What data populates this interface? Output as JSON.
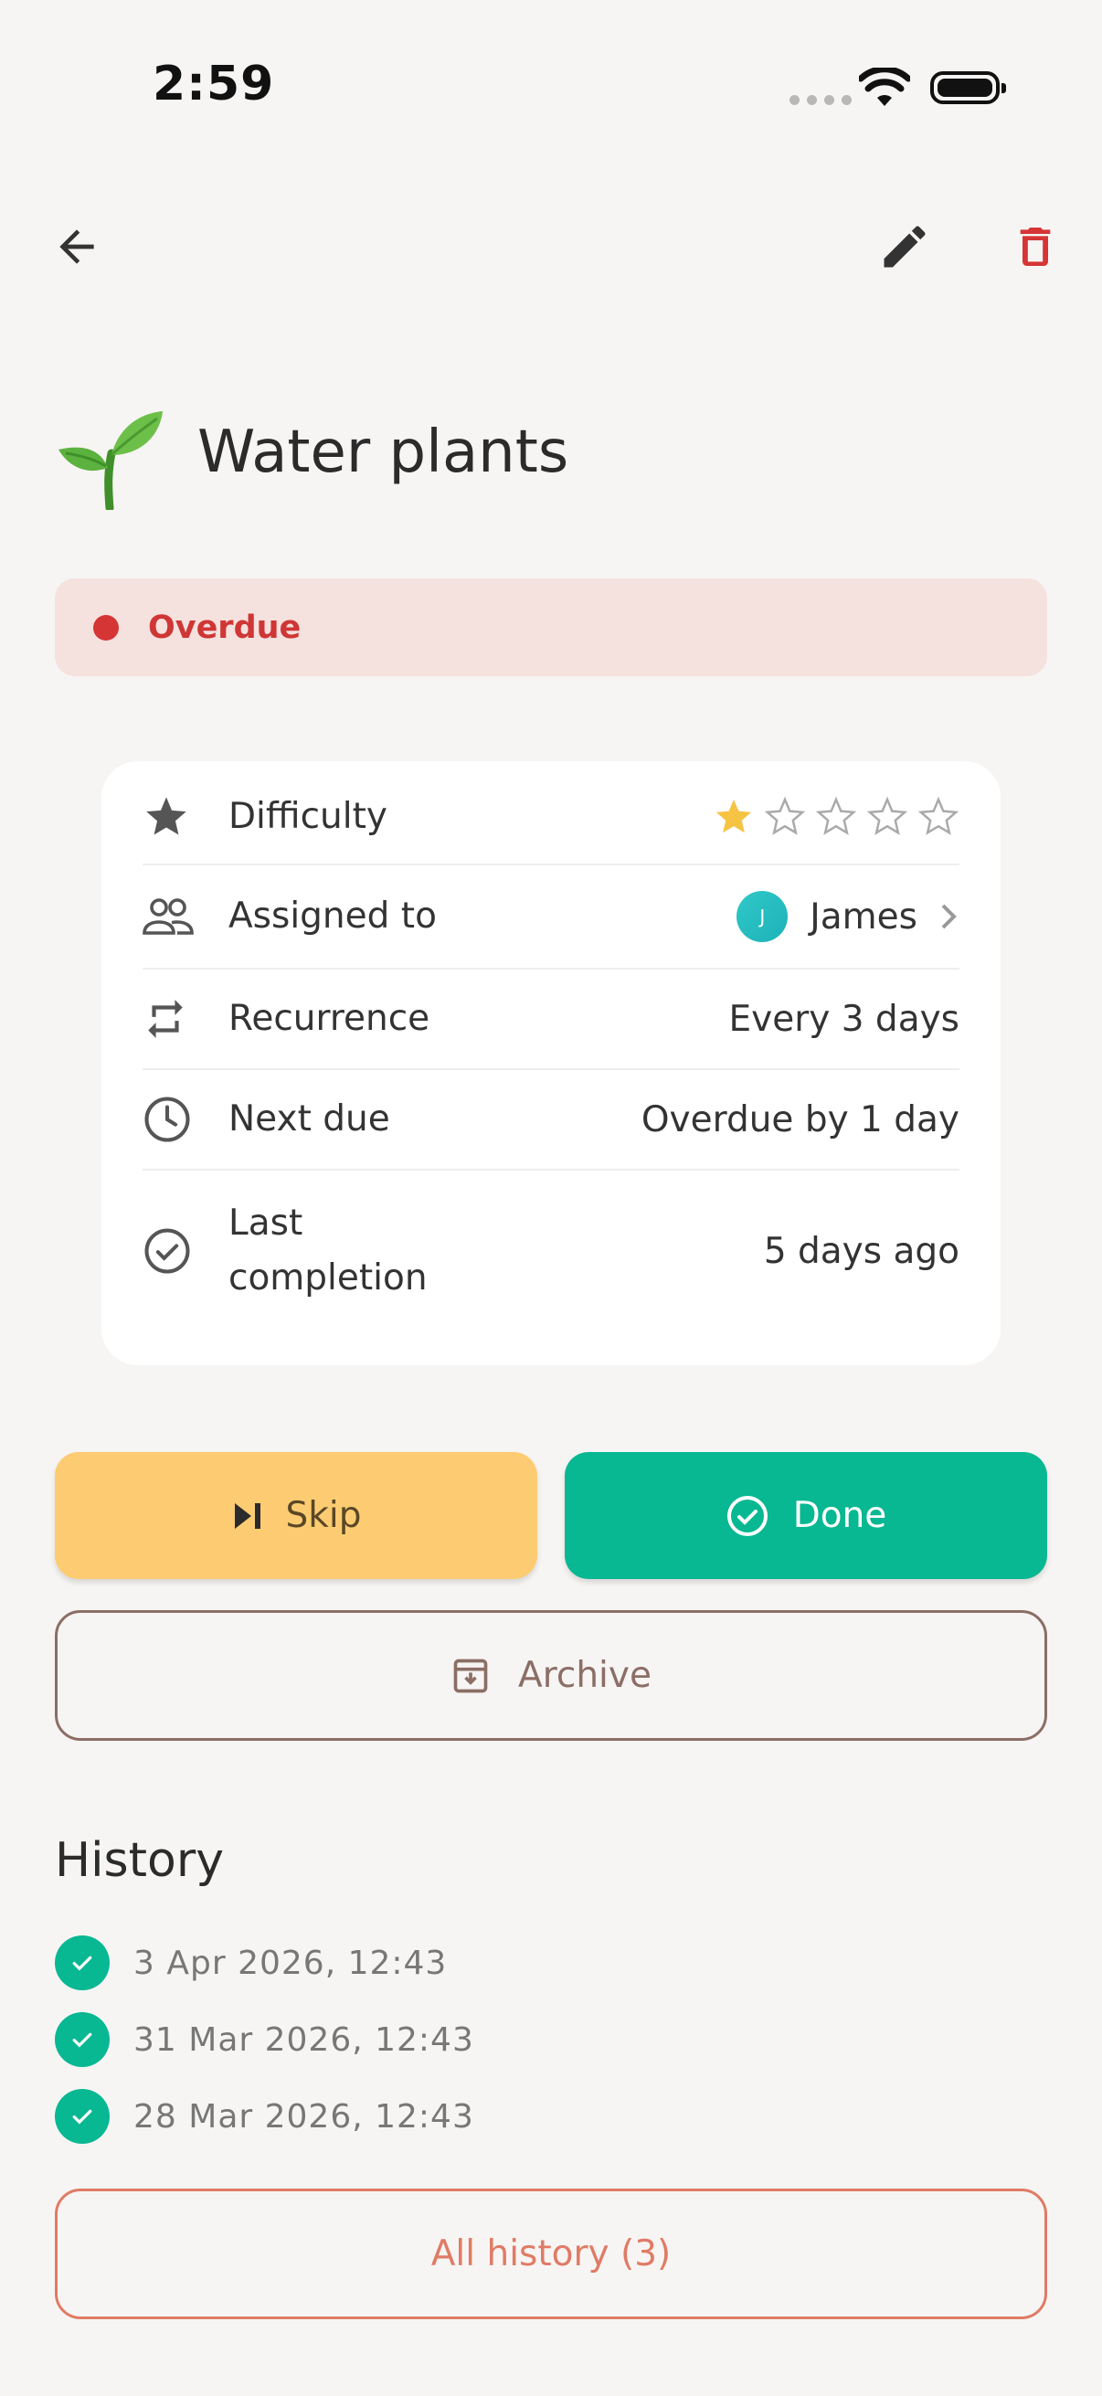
{
  "status_bar": {
    "time": "2:59"
  },
  "chore": {
    "title": "Water plants",
    "icon": "seedling-emoji",
    "status": "Overdue",
    "status_color": "#d63535"
  },
  "details": {
    "difficulty": {
      "label": "Difficulty",
      "rating": 1,
      "max": 5
    },
    "assigned": {
      "label": "Assigned to",
      "avatar_initial": "J",
      "value": "James"
    },
    "recurrence": {
      "label": "Recurrence",
      "value": "Every 3 days"
    },
    "next_due": {
      "label": "Next due",
      "value": "Overdue by 1 day"
    },
    "last_completion": {
      "label": "Last completion",
      "value": "5 days ago"
    }
  },
  "actions": {
    "skip": "Skip",
    "done": "Done",
    "archive": "Archive"
  },
  "history": {
    "title": "History",
    "items": [
      "3 Apr 2026, 12:43",
      "31 Mar 2026, 12:43",
      "28 Mar 2026, 12:43"
    ],
    "all_label": "All history (3)"
  },
  "colors": {
    "accent_green": "#07b892",
    "skip_yellow": "#fdcc72",
    "delete_red": "#d63535",
    "archive_brown": "#8b6e66",
    "history_link": "#e07b66"
  }
}
